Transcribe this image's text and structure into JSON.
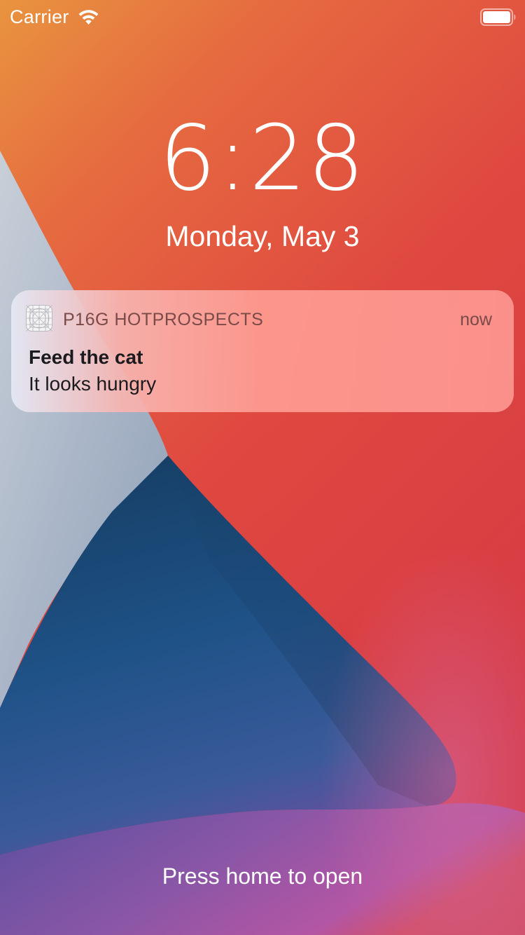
{
  "status_bar": {
    "carrier": "Carrier",
    "wifi_icon": "wifi-icon",
    "battery_icon": "battery-icon"
  },
  "lock_screen": {
    "time": "6:28",
    "date": "Monday, May 3",
    "unlock_hint": "Press home to open"
  },
  "notification": {
    "app_icon": "app-placeholder-icon",
    "app_name": "P16G HOTPROSPECTS",
    "time": "now",
    "title": "Feed the cat",
    "body": "It looks hungry"
  },
  "colors": {
    "wallpaper_orange": "#e8913f",
    "wallpaper_red": "#dc3c40",
    "wallpaper_blue": "#1d4f7e",
    "wallpaper_gray": "#b4bfd0",
    "wallpaper_purple": "#8552a8",
    "notification_tint": "#fd968f",
    "text_on_wallpaper": "#ffffff"
  }
}
